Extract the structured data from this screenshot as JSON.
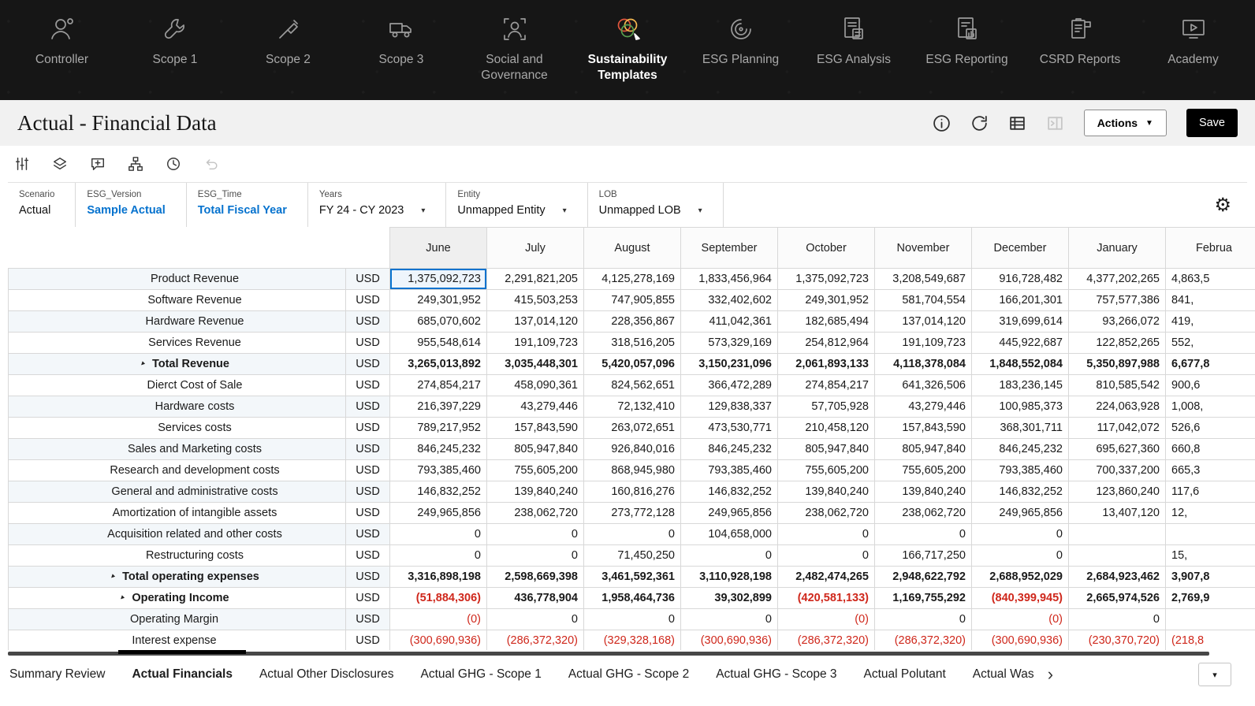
{
  "app": {
    "accent_blue": "#0572ce",
    "negative_red": "#cf271b",
    "nav_bg": "#161616"
  },
  "nav": {
    "items": [
      {
        "label": "Controller",
        "icon": "person",
        "active": false
      },
      {
        "label": "Scope 1",
        "icon": "wrench",
        "active": false
      },
      {
        "label": "Scope 2",
        "icon": "tool",
        "active": false
      },
      {
        "label": "Scope 3",
        "icon": "truck",
        "active": false
      },
      {
        "label": "Social and Governance",
        "icon": "person-frame",
        "active": false
      },
      {
        "label": "Sustainability Templates",
        "icon": "venn-pen",
        "active": true
      },
      {
        "label": "ESG Planning",
        "icon": "spiral-globe",
        "active": false
      },
      {
        "label": "ESG Analysis",
        "icon": "document-calc",
        "active": false
      },
      {
        "label": "ESG Reporting",
        "icon": "document-report",
        "active": false
      },
      {
        "label": "CSRD Reports",
        "icon": "clipboard-flag",
        "active": false
      },
      {
        "label": "Academy",
        "icon": "play-screen",
        "active": false
      }
    ]
  },
  "header": {
    "title": "Actual - Financial Data",
    "icons": [
      {
        "name": "info",
        "disabled": false
      },
      {
        "name": "refresh",
        "disabled": false
      },
      {
        "name": "member-list",
        "disabled": false
      },
      {
        "name": "panel-toggle",
        "disabled": true
      }
    ],
    "actions_label": "Actions",
    "save_label": "Save"
  },
  "toolbar": {
    "icons": [
      {
        "name": "adjust-sliders",
        "disabled": false
      },
      {
        "name": "layers",
        "disabled": false
      },
      {
        "name": "comment-add",
        "disabled": false
      },
      {
        "name": "hierarchy",
        "disabled": false
      },
      {
        "name": "history",
        "disabled": false
      },
      {
        "name": "undo",
        "disabled": true
      }
    ]
  },
  "pov": {
    "segments": [
      {
        "label": "Scenario",
        "value": "Actual",
        "style": "plain",
        "dropdown": false
      },
      {
        "label": "ESG_Version",
        "value": "Sample Actual",
        "style": "link",
        "dropdown": false
      },
      {
        "label": "ESG_Time",
        "value": "Total Fiscal Year",
        "style": "link",
        "dropdown": false
      },
      {
        "label": "Years",
        "value": "FY 24 - CY 2023",
        "style": "plain",
        "dropdown": true
      },
      {
        "label": "Entity",
        "value": "Unmapped Entity",
        "style": "plain",
        "dropdown": true
      },
      {
        "label": "LOB",
        "value": "Unmapped LOB",
        "style": "plain",
        "dropdown": true
      }
    ],
    "gear_icon": "settings-gear"
  },
  "grid": {
    "columns": [
      "June",
      "July",
      "August",
      "September",
      "October",
      "November",
      "December",
      "January",
      "Februa"
    ],
    "currency_label": "USD",
    "selected_cell": {
      "row": 0,
      "col": 0
    },
    "rows": [
      {
        "label": "Product Revenue",
        "indent": 2,
        "bold": false,
        "collapsible": false,
        "values": [
          "1,375,092,723",
          "2,291,821,205",
          "4,125,278,169",
          "1,833,456,964",
          "1,375,092,723",
          "3,208,549,687",
          "916,728,482",
          "4,377,202,265",
          "4,863,5"
        ]
      },
      {
        "label": "Software Revenue",
        "indent": 2,
        "bold": false,
        "collapsible": false,
        "values": [
          "249,301,952",
          "415,503,253",
          "747,905,855",
          "332,402,602",
          "249,301,952",
          "581,704,554",
          "166,201,301",
          "757,577,386",
          "841,"
        ]
      },
      {
        "label": "Hardware Revenue",
        "indent": 2,
        "bold": false,
        "collapsible": false,
        "values": [
          "685,070,602",
          "137,014,120",
          "228,356,867",
          "411,042,361",
          "182,685,494",
          "137,014,120",
          "319,699,614",
          "93,266,072",
          "419,"
        ]
      },
      {
        "label": "Services Revenue",
        "indent": 2,
        "bold": false,
        "collapsible": false,
        "values": [
          "955,548,614",
          "191,109,723",
          "318,516,205",
          "573,329,169",
          "254,812,964",
          "191,109,723",
          "445,922,687",
          "122,852,265",
          "552,"
        ]
      },
      {
        "label": "Total Revenue",
        "indent": 1,
        "bold": true,
        "collapsible": true,
        "values": [
          "3,265,013,892",
          "3,035,448,301",
          "5,420,057,096",
          "3,150,231,096",
          "2,061,893,133",
          "4,118,378,084",
          "1,848,552,084",
          "5,350,897,988",
          "6,677,8"
        ]
      },
      {
        "label": "Dierct Cost of Sale",
        "indent": 2,
        "bold": false,
        "collapsible": false,
        "values": [
          "274,854,217",
          "458,090,361",
          "824,562,651",
          "366,472,289",
          "274,854,217",
          "641,326,506",
          "183,236,145",
          "810,585,542",
          "900,6"
        ]
      },
      {
        "label": "Hardware costs",
        "indent": 2,
        "bold": false,
        "collapsible": false,
        "values": [
          "216,397,229",
          "43,279,446",
          "72,132,410",
          "129,838,337",
          "57,705,928",
          "43,279,446",
          "100,985,373",
          "224,063,928",
          "1,008,"
        ]
      },
      {
        "label": "Services costs",
        "indent": 2,
        "bold": false,
        "collapsible": false,
        "values": [
          "789,217,952",
          "157,843,590",
          "263,072,651",
          "473,530,771",
          "210,458,120",
          "157,843,590",
          "368,301,711",
          "117,042,072",
          "526,6"
        ]
      },
      {
        "label": "Sales and Marketing costs",
        "indent": 2,
        "bold": false,
        "collapsible": false,
        "values": [
          "846,245,232",
          "805,947,840",
          "926,840,016",
          "846,245,232",
          "805,947,840",
          "805,947,840",
          "846,245,232",
          "695,627,360",
          "660,8"
        ]
      },
      {
        "label": "Research and development costs",
        "indent": 2,
        "bold": false,
        "collapsible": false,
        "values": [
          "793,385,460",
          "755,605,200",
          "868,945,980",
          "793,385,460",
          "755,605,200",
          "755,605,200",
          "793,385,460",
          "700,337,200",
          "665,3"
        ]
      },
      {
        "label": "General and administrative costs",
        "indent": 2,
        "bold": false,
        "collapsible": false,
        "values": [
          "146,832,252",
          "139,840,240",
          "160,816,276",
          "146,832,252",
          "139,840,240",
          "139,840,240",
          "146,832,252",
          "123,860,240",
          "117,6"
        ]
      },
      {
        "label": "Amortization of intangible assets",
        "indent": 2,
        "bold": false,
        "collapsible": false,
        "values": [
          "249,965,856",
          "238,062,720",
          "273,772,128",
          "249,965,856",
          "238,062,720",
          "238,062,720",
          "249,965,856",
          "13,407,120",
          "12,"
        ]
      },
      {
        "label": "Acquisition related and other costs",
        "indent": 2,
        "bold": false,
        "collapsible": false,
        "values": [
          "0",
          "0",
          "0",
          "104,658,000",
          "0",
          "0",
          "0",
          "",
          ""
        ]
      },
      {
        "label": "Restructuring costs",
        "indent": 2,
        "bold": false,
        "collapsible": false,
        "values": [
          "0",
          "0",
          "71,450,250",
          "0",
          "0",
          "166,717,250",
          "0",
          "",
          "15,"
        ]
      },
      {
        "label": "Total operating expenses",
        "indent": 1,
        "bold": true,
        "collapsible": true,
        "values": [
          "3,316,898,198",
          "2,598,669,398",
          "3,461,592,361",
          "3,110,928,198",
          "2,482,474,265",
          "2,948,622,792",
          "2,688,952,029",
          "2,684,923,462",
          "3,907,8"
        ]
      },
      {
        "label": "Operating Income",
        "indent": 0,
        "bold": true,
        "collapsible": true,
        "values": [
          "(51,884,306)",
          "436,778,904",
          "1,958,464,736",
          "39,302,899",
          "(420,581,133)",
          "1,169,755,292",
          "(840,399,945)",
          "2,665,974,526",
          "2,769,9"
        ]
      },
      {
        "label": "Operating Margin",
        "indent": 0,
        "bold": false,
        "collapsible": false,
        "values": [
          "(0)",
          "0",
          "0",
          "0",
          "(0)",
          "0",
          "(0)",
          "0",
          ""
        ]
      },
      {
        "label": "Interest expense",
        "indent": 0,
        "bold": false,
        "collapsible": false,
        "values": [
          "(300,690,936)",
          "(286,372,320)",
          "(329,328,168)",
          "(300,690,936)",
          "(286,372,320)",
          "(286,372,320)",
          "(300,690,936)",
          "(230,370,720)",
          "(218,8"
        ]
      }
    ]
  },
  "tabs": {
    "items": [
      {
        "label": "Summary Review",
        "active": false,
        "clipped": false
      },
      {
        "label": "Actual Financials",
        "active": true,
        "clipped": false
      },
      {
        "label": "Actual Other Disclosures",
        "active": false,
        "clipped": false
      },
      {
        "label": "Actual GHG - Scope 1",
        "active": false,
        "clipped": false
      },
      {
        "label": "Actual GHG - Scope 2",
        "active": false,
        "clipped": false
      },
      {
        "label": "Actual GHG - Scope 3",
        "active": false,
        "clipped": false
      },
      {
        "label": "Actual Polutant",
        "active": false,
        "clipped": false
      },
      {
        "label": "Actual Was",
        "active": false,
        "clipped": true
      }
    ],
    "chevron": "›",
    "overflow_caret": "▾"
  }
}
